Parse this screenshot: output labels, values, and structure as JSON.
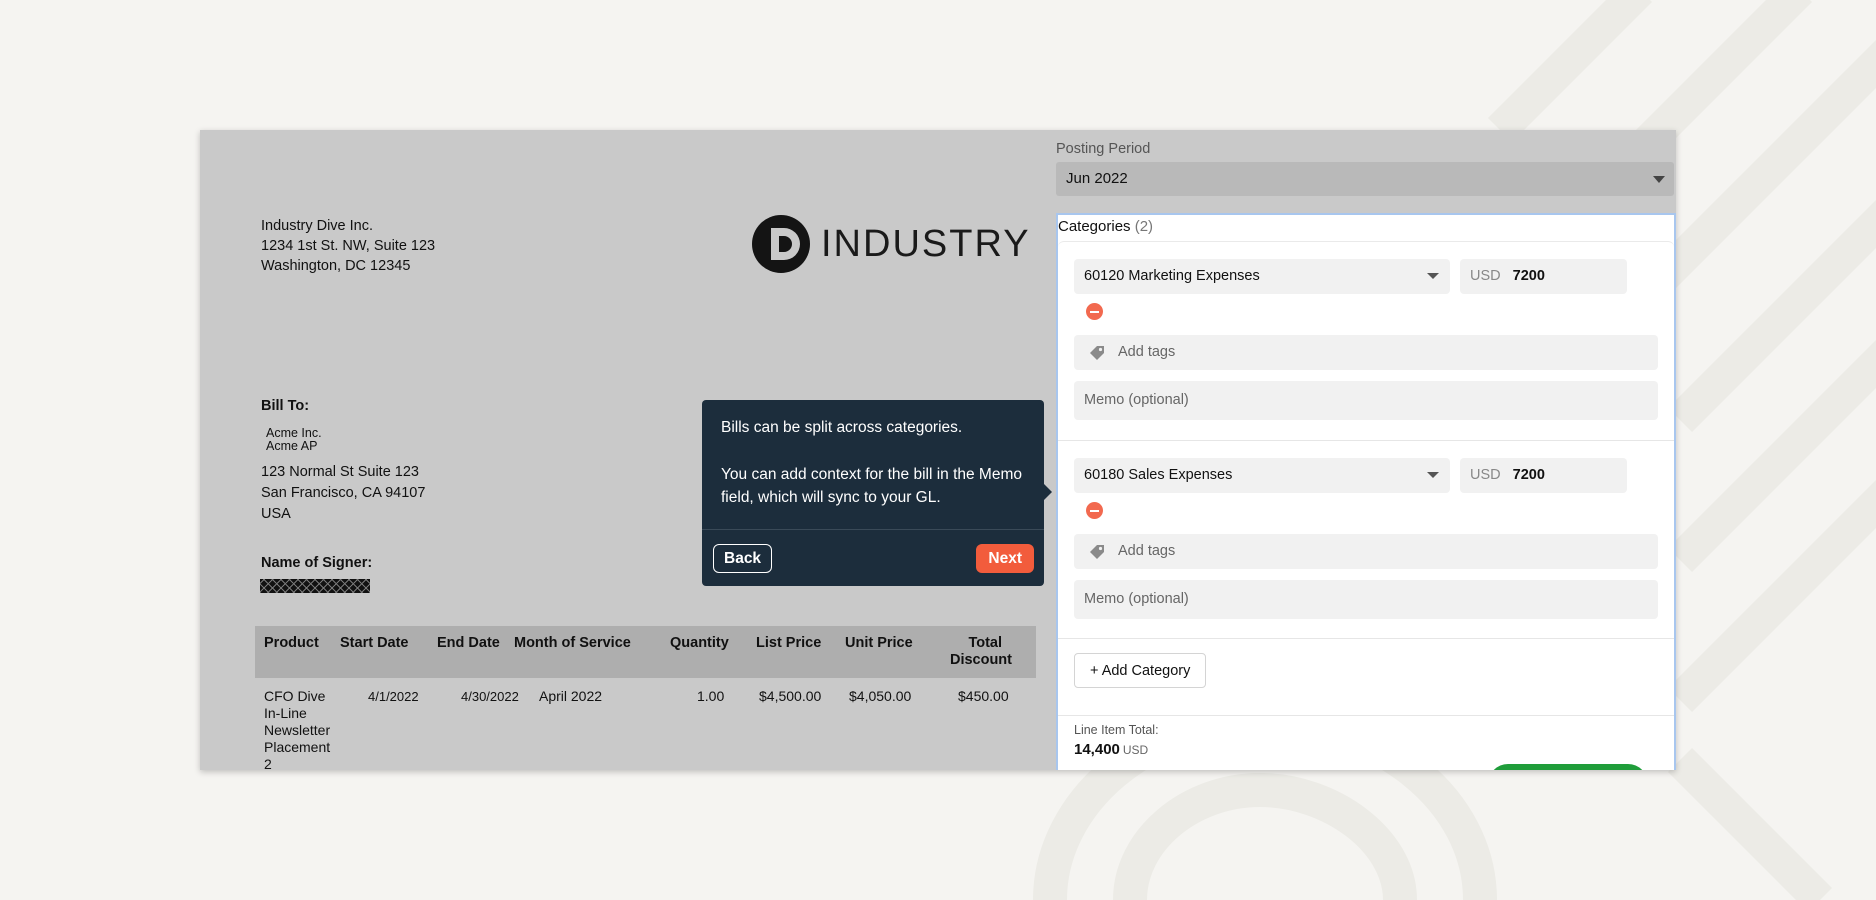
{
  "invoice": {
    "vendor_address": [
      "Industry Dive Inc.",
      "1234 1st St. NW, Suite 123",
      "Washington, DC 12345"
    ],
    "logo_text": "INDUSTRY D",
    "bill_to_label": "Bill To:",
    "bill_to_company": [
      "Acme Inc.",
      "Acme AP"
    ],
    "bill_to_address": [
      "123 Normal St Suite 123",
      "San Francisco, CA 94107",
      "USA"
    ],
    "signer_label": "Name of Signer:",
    "table": {
      "headers": [
        "Product",
        "Start Date",
        "End Date",
        "Month of Service",
        "Quantity",
        "List Price",
        "Unit Price",
        "Total",
        "Discount"
      ],
      "row": [
        "CFO Dive",
        "In-Line",
        "Newsletter",
        "Placement",
        "2",
        "4/1/2022",
        "4/30/2022",
        "April 2022",
        "1.00",
        "$4,500.00",
        "$4,050.00",
        "$450.00"
      ]
    }
  },
  "tooltip": {
    "line1": "Bills can be split across categories.",
    "line2": "You can add context for the bill in the Memo field, which will sync to your GL.",
    "back_label": "Back",
    "next_label": "Next"
  },
  "panel": {
    "posting_period_label": "Posting Period",
    "posting_period_value": "Jun 2022",
    "categories_label": "Categories",
    "categories_count": "(2)",
    "categories": [
      {
        "account": "60120 Marketing Expenses",
        "currency": "USD",
        "amount": "7200",
        "tags_placeholder": "Add tags",
        "memo_placeholder": "Memo (optional)"
      },
      {
        "account": "60180 Sales Expenses",
        "currency": "USD",
        "amount": "7200",
        "tags_placeholder": "Add tags",
        "memo_placeholder": "Memo (optional)"
      }
    ],
    "add_category_label": "+ Add Category",
    "line_item_total_label": "Line Item Total:",
    "line_item_total_value": "14,400",
    "line_item_total_unit": "USD"
  },
  "colors": {
    "tooltip_bg": "#1c2d3c",
    "next_button": "#f25c3c",
    "remove_icon": "#f2694f",
    "focus_border": "#a8c6ee",
    "overlay_gray": "#c9c9c9"
  }
}
